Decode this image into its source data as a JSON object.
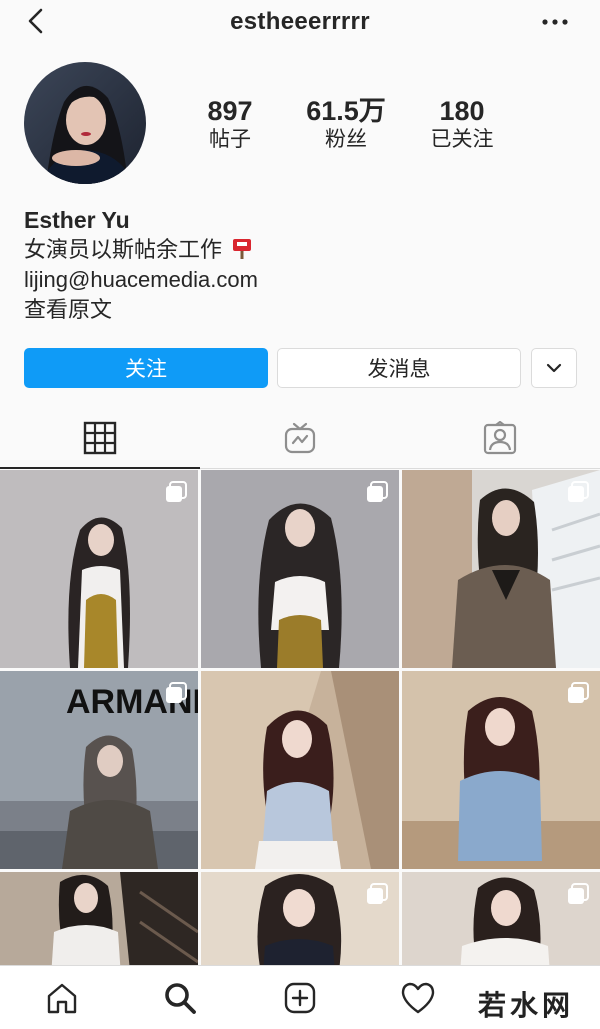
{
  "header": {
    "username": "estheeerrrrr"
  },
  "stats": [
    {
      "value": "897",
      "label": "帖子"
    },
    {
      "value": "61.5万",
      "label": "粉丝"
    },
    {
      "value": "180",
      "label": "已关注"
    }
  ],
  "bio": {
    "name": "Esther Yu",
    "line1": "女演员以斯帖余工作",
    "email": "lijing@huacemedia.com",
    "translate": "查看原文"
  },
  "actions": {
    "follow": "关注",
    "message": "发消息"
  },
  "grid": {
    "posts": [
      {
        "multi": true
      },
      {
        "multi": true
      },
      {
        "multi": true
      },
      {
        "multi": true,
        "sign_text": "ARMANI BOX"
      },
      {
        "multi": false
      },
      {
        "multi": true
      },
      {
        "multi": false
      },
      {
        "multi": true
      },
      {
        "multi": true
      }
    ]
  },
  "watermark": {
    "text": "若水网"
  },
  "colors": {
    "accent": "#0f9bf7",
    "text": "#262626",
    "border": "#dbdbdb",
    "background": "#fafafa"
  }
}
